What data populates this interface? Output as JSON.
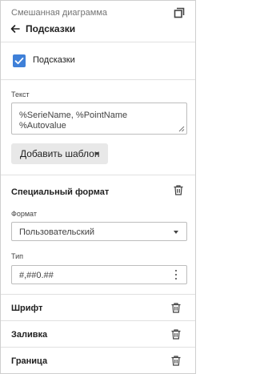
{
  "header": {
    "app_title": "Смешанная диаграмма",
    "panel_title": "Подсказки"
  },
  "tooltips": {
    "checkbox_label": "Подсказки",
    "checked": true
  },
  "text_section": {
    "label": "Текст",
    "lines": [
      "%SerieName, %PointName",
      "%Autovalue"
    ],
    "template_button_label": "Добавить шаблон"
  },
  "special_format": {
    "title": "Специальный формат",
    "format_label": "Формат",
    "format_value": "Пользовательский",
    "type_label": "Тип",
    "type_value": "#,##0.##"
  },
  "sections": {
    "font": "Шрифт",
    "fill": "Заливка",
    "border": "Граница"
  },
  "colors": {
    "accent": "#3f80d8",
    "border": "#e0e0e0",
    "button_bg": "#e8e8e8"
  }
}
